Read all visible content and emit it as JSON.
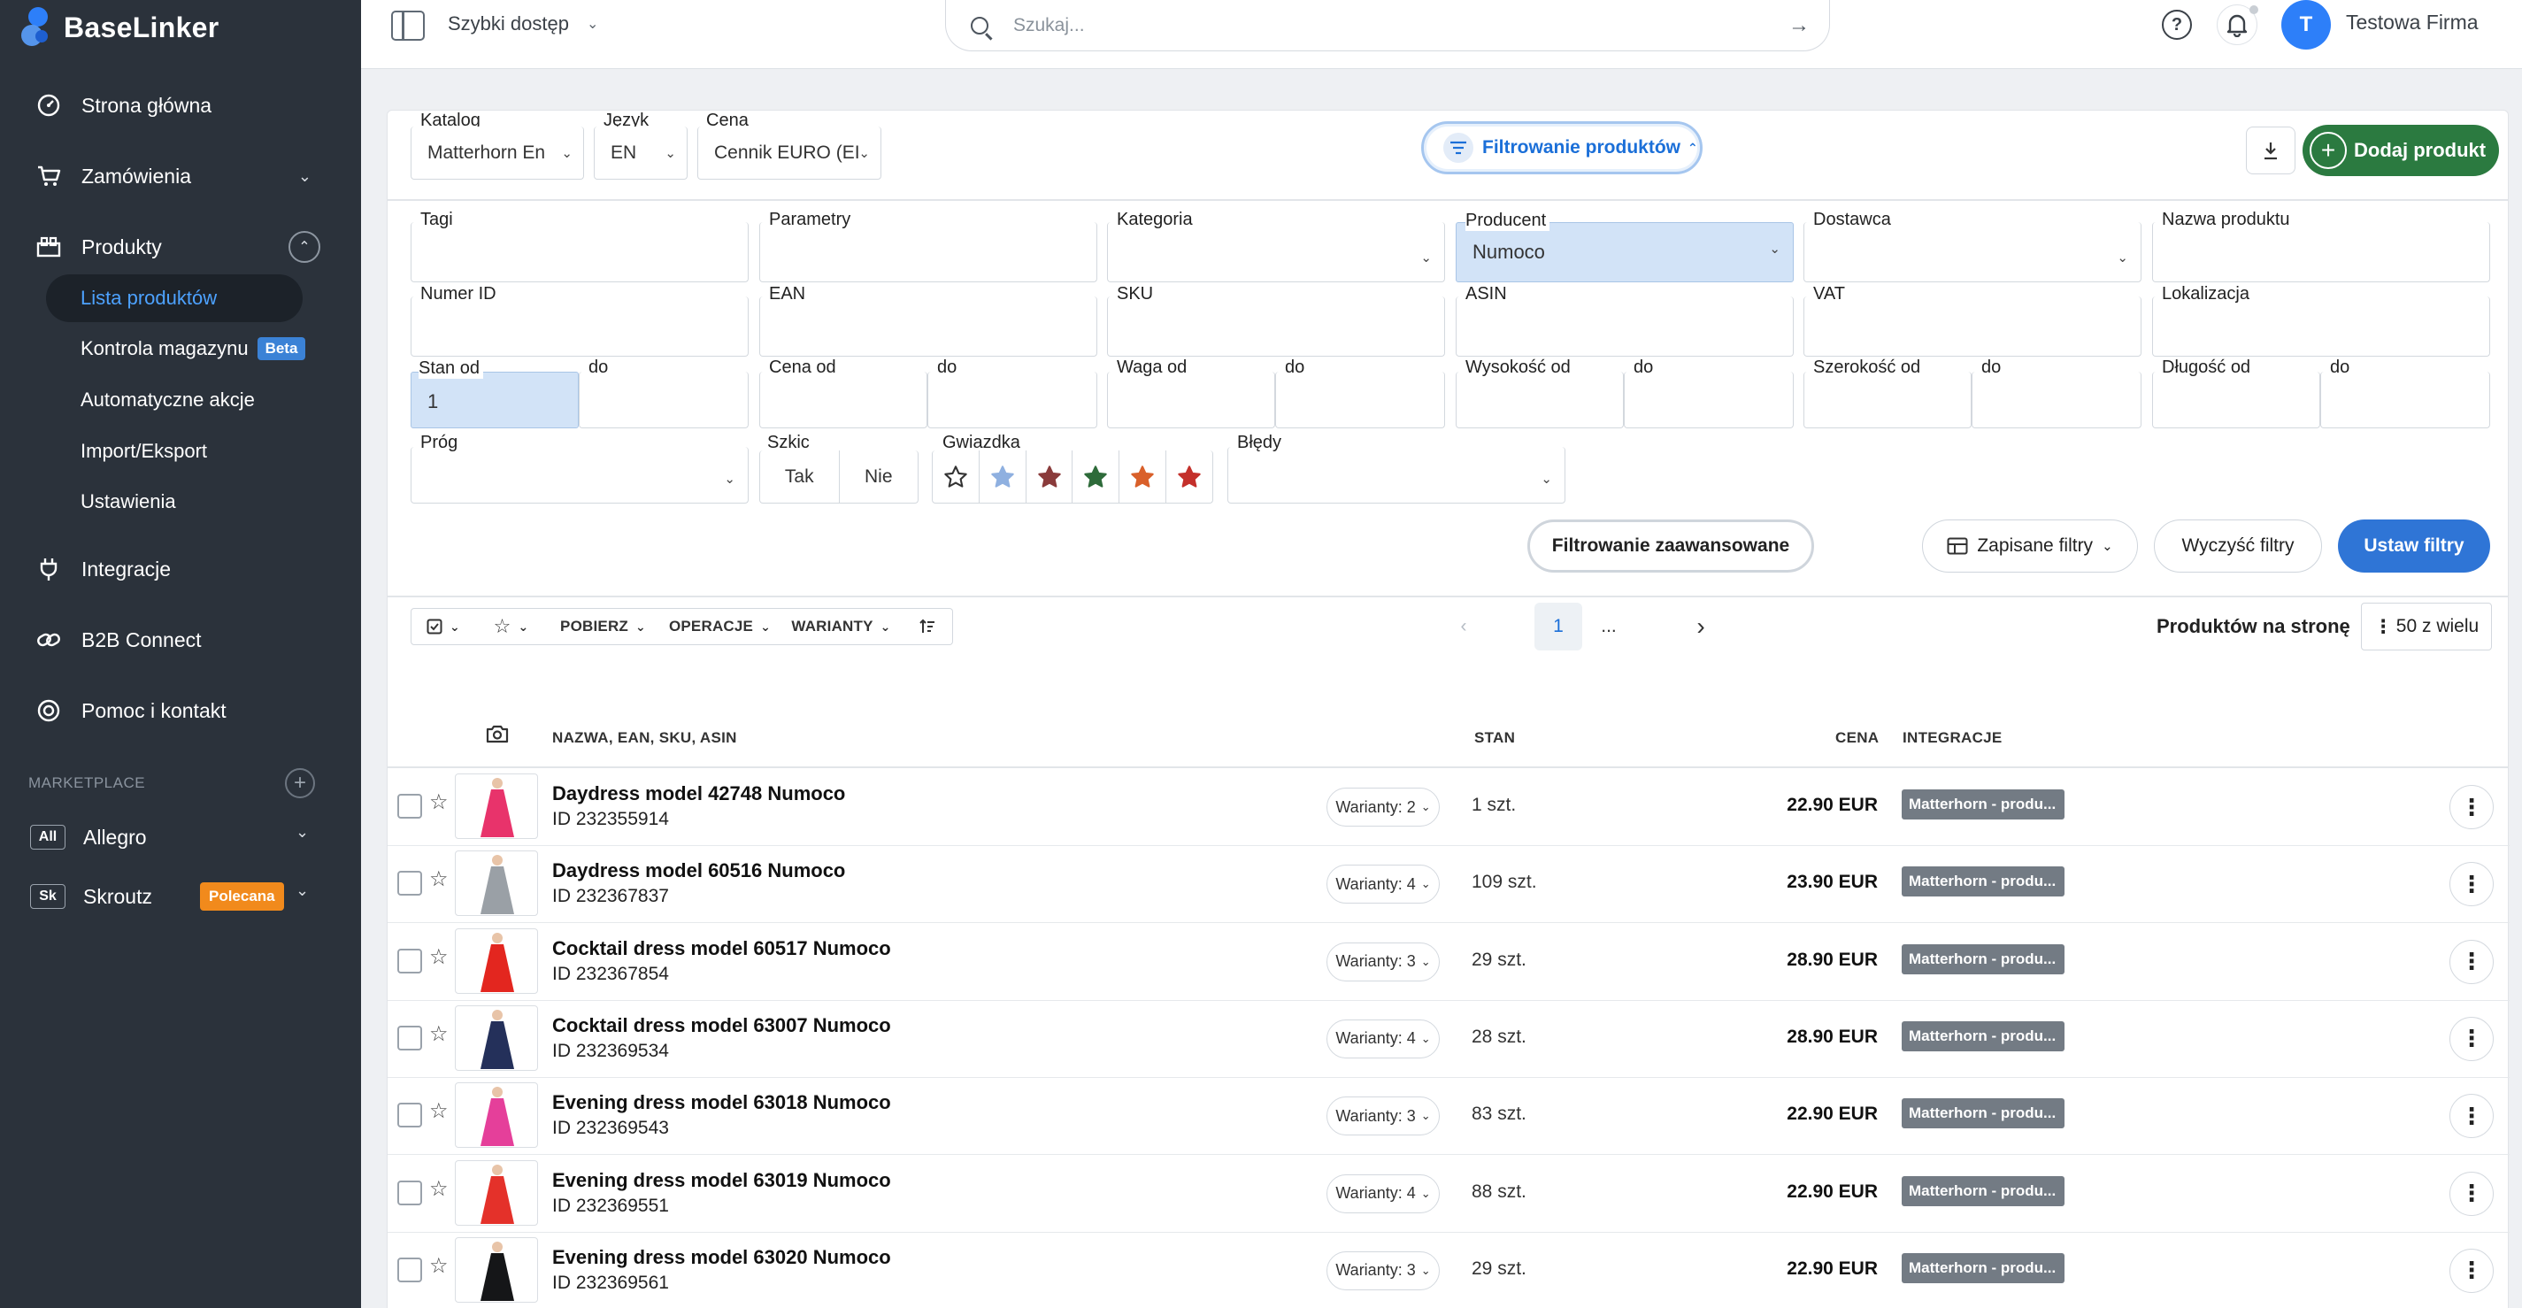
{
  "sidebar": {
    "logo": "BaseLinker",
    "nav": {
      "home": "Strona główna",
      "orders": "Zamówienia",
      "products": "Produkty",
      "integrations": "Integracje",
      "b2b": "B2B Connect",
      "help": "Pomoc i kontakt"
    },
    "products_sub": {
      "list": "Lista produktów",
      "warehouse": "Kontrola magazynu",
      "beta": "Beta",
      "auto": "Automatyczne akcje",
      "import": "Import/Eksport",
      "settings": "Ustawienia"
    },
    "marketplace": {
      "title": "MARKETPLACE",
      "allegro_badge": "All",
      "allegro": "Allegro",
      "skroutz_badge": "Sk",
      "skroutz": "Skroutz",
      "recommended": "Polecana"
    }
  },
  "topbar": {
    "quick_access": "Szybki dostęp",
    "search_placeholder": "Szukaj...",
    "avatar_letter": "T",
    "company": "Testowa Firma"
  },
  "toolbar": {
    "catalog_label": "Katalog",
    "catalog_value": "Matterhorn En",
    "lang_label": "Język",
    "lang_value": "EN",
    "price_label": "Cena",
    "price_value": "Cennik EURO (EI",
    "filter_toggle": "Filtrowanie produktów",
    "add_product": "Dodaj produkt"
  },
  "filters": {
    "tags": "Tagi",
    "params": "Parametry",
    "category": "Kategoria",
    "producer": "Producent",
    "producer_value": "Numoco",
    "supplier": "Dostawca",
    "product_name": "Nazwa produktu",
    "id_number": "Numer ID",
    "ean": "EAN",
    "sku": "SKU",
    "asin": "ASIN",
    "vat": "VAT",
    "location": "Lokalizacja",
    "stock_from": "Stan od",
    "stock_from_value": "1",
    "to": "do",
    "price_from": "Cena od",
    "weight_from": "Waga od",
    "height_from": "Wysokość od",
    "width_from": "Szerokość od",
    "length_from": "Długość od",
    "threshold": "Próg",
    "draft": "Szkic",
    "draft_yes": "Tak",
    "draft_no": "Nie",
    "star": "Gwiazdka",
    "errors": "Błędy",
    "advanced": "Filtrowanie zaawansowane",
    "saved": "Zapisane filtry",
    "clear": "Wyczyść filtry",
    "apply": "Ustaw filtry",
    "star_colors": [
      "#ffffff",
      "#8fb0e0",
      "#8a3b3b",
      "#2e6b3a",
      "#d9602a",
      "#c4302b"
    ]
  },
  "list_toolbar": {
    "download": "POBIERZ",
    "operations": "OPERACJE",
    "variants": "WARIANTY",
    "page": "1",
    "ellipsis": "...",
    "per_page_label": "Produktów na stronę",
    "per_page_value": "50 z wielu"
  },
  "table": {
    "headers": {
      "name": "NAZWA, EAN, SKU, ASIN",
      "stock": "STAN",
      "price": "CENA",
      "integrations": "INTEGRACJE"
    },
    "rows": [
      {
        "name": "Daydress model 42748 Numoco",
        "id": "ID 232355914",
        "variants": "Warianty: 2",
        "stock": "1 szt.",
        "price": "22.90 EUR",
        "integration": "Matterhorn - produ...",
        "color": "#e8336b"
      },
      {
        "name": "Daydress model 60516 Numoco",
        "id": "ID 232367837",
        "variants": "Warianty: 4",
        "stock": "109 szt.",
        "price": "23.90 EUR",
        "integration": "Matterhorn - produ...",
        "color": "#9aa0a6"
      },
      {
        "name": "Cocktail dress model 60517 Numoco",
        "id": "ID 232367854",
        "variants": "Warianty: 3",
        "stock": "29 szt.",
        "price": "28.90 EUR",
        "integration": "Matterhorn - produ...",
        "color": "#e3261f"
      },
      {
        "name": "Cocktail dress model 63007 Numoco",
        "id": "ID 232369534",
        "variants": "Warianty: 4",
        "stock": "28 szt.",
        "price": "28.90 EUR",
        "integration": "Matterhorn - produ...",
        "color": "#24305a"
      },
      {
        "name": "Evening dress model 63018 Numoco",
        "id": "ID 232369543",
        "variants": "Warianty: 3",
        "stock": "83 szt.",
        "price": "22.90 EUR",
        "integration": "Matterhorn - produ...",
        "color": "#e53f9a"
      },
      {
        "name": "Evening dress model 63019 Numoco",
        "id": "ID 232369551",
        "variants": "Warianty: 4",
        "stock": "88 szt.",
        "price": "22.90 EUR",
        "integration": "Matterhorn - produ...",
        "color": "#e4312a"
      },
      {
        "name": "Evening dress model 63020 Numoco",
        "id": "ID 232369561",
        "variants": "Warianty: 3",
        "stock": "29 szt.",
        "price": "22.90 EUR",
        "integration": "Matterhorn - produ...",
        "color": "#151618"
      }
    ]
  }
}
